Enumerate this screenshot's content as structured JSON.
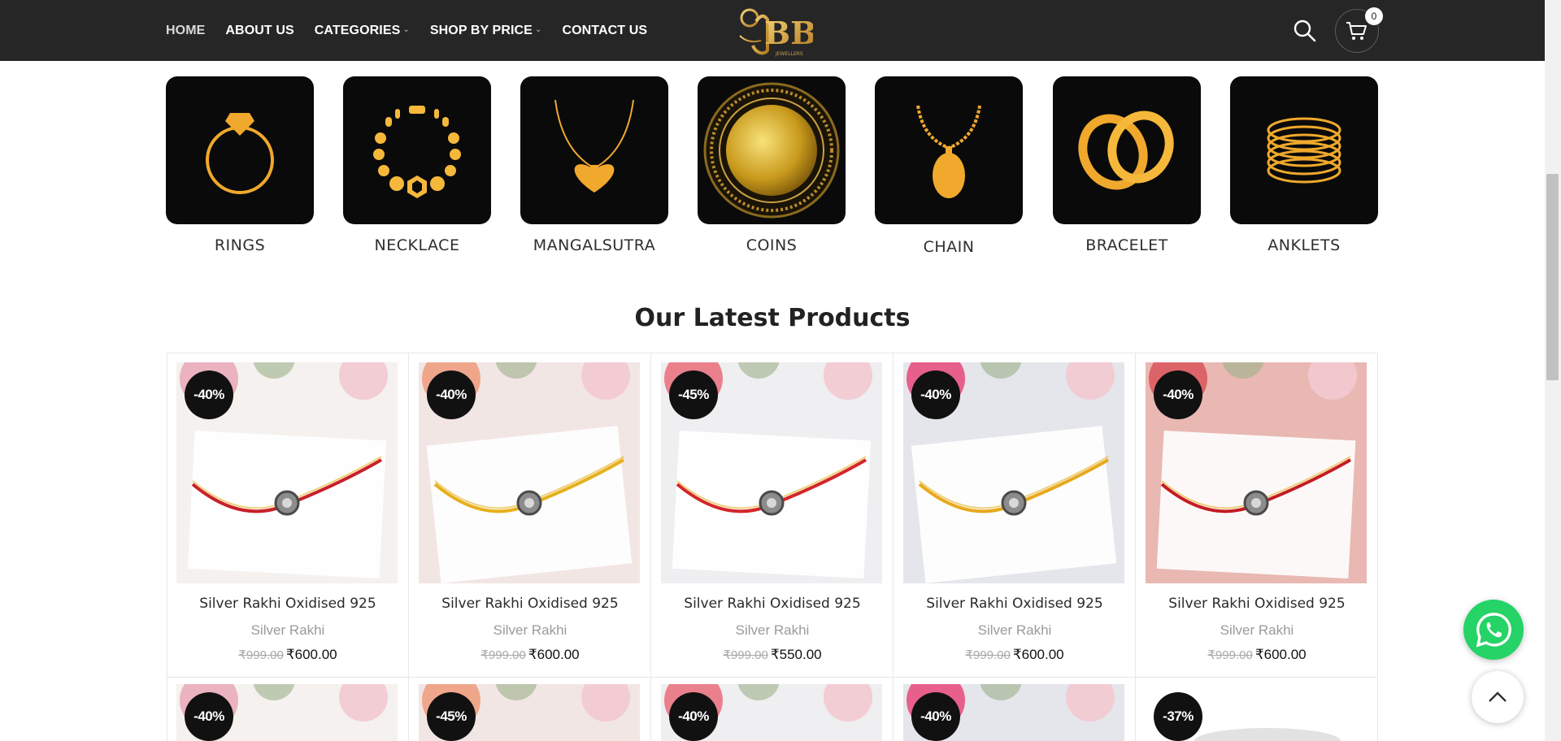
{
  "nav": {
    "items": [
      {
        "label": "HOME",
        "dropdown": false
      },
      {
        "label": "ABOUT US",
        "dropdown": false
      },
      {
        "label": "CATEGORIES",
        "dropdown": true
      },
      {
        "label": "SHOP BY PRICE",
        "dropdown": true
      },
      {
        "label": "CONTACT US",
        "dropdown": false
      }
    ]
  },
  "logo": {
    "sub": "JEWELLERS"
  },
  "cart": {
    "count": "0"
  },
  "categories": [
    {
      "label": "RINGS",
      "icon": "ring-icon"
    },
    {
      "label": "NECKLACE",
      "icon": "necklace-icon"
    },
    {
      "label": "MANGALSUTRA",
      "icon": "mangalsutra-icon"
    },
    {
      "label": "COINS",
      "icon": "coin-icon"
    },
    {
      "label": "CHAIN",
      "icon": "chain-icon"
    },
    {
      "label": "BRACELET",
      "icon": "bracelet-icon"
    },
    {
      "label": "ANKLETS",
      "icon": "anklet-icon"
    }
  ],
  "section_title": "Our Latest Products",
  "products": [
    {
      "badge": "-40%",
      "name": "Silver Rakhi Oxidised 925",
      "category": "Silver Rakhi",
      "old_price": "₹999.00",
      "price": "₹600.00",
      "thread": "#c8202a"
    },
    {
      "badge": "-40%",
      "name": "Silver Rakhi Oxidised 925",
      "category": "Silver Rakhi",
      "old_price": "₹999.00",
      "price": "₹600.00",
      "thread": "#e6b01a"
    },
    {
      "badge": "-45%",
      "name": "Silver Rakhi Oxidised 925",
      "category": "Silver Rakhi",
      "old_price": "₹999.00",
      "price": "₹550.00",
      "thread": "#d3262a"
    },
    {
      "badge": "-40%",
      "name": "Silver Rakhi Oxidised 925",
      "category": "Silver Rakhi",
      "old_price": "₹999.00",
      "price": "₹600.00",
      "thread": "#e8a81d"
    },
    {
      "badge": "-40%",
      "name": "Silver Rakhi Oxidised 925",
      "category": "Silver Rakhi",
      "old_price": "₹999.00",
      "price": "₹600.00",
      "thread": "#c41c24"
    }
  ],
  "products_row2": [
    {
      "badge": "-40%"
    },
    {
      "badge": "-45%"
    },
    {
      "badge": "-40%"
    },
    {
      "badge": "-40%"
    },
    {
      "badge": "-37%"
    }
  ],
  "colors": {
    "header": "#262626",
    "gold": "#f0a92c",
    "whatsapp": "#25d366"
  }
}
